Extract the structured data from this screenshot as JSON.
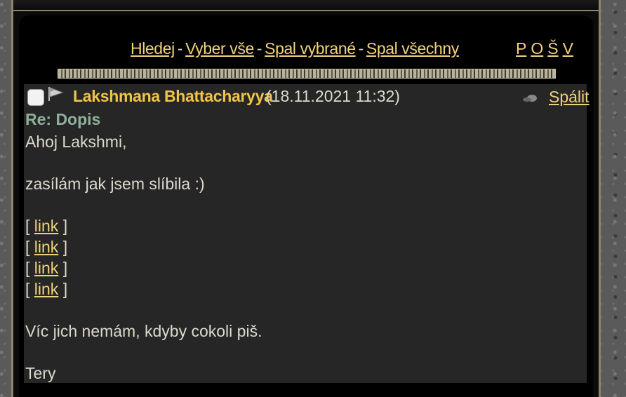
{
  "nav": {
    "search": "Hledej",
    "select_all": "Vyber vše",
    "burn_selected": "Spal vybrané",
    "burn_all": "Spal všechny",
    "separator": "-",
    "letters": [
      "P",
      "O",
      "Š",
      "V"
    ]
  },
  "message": {
    "sender": "Lakshmana Bhattacharyya",
    "date": "(18.11.2021 11:32)",
    "burn_label": "Spálit",
    "subject": "Re: Dopis",
    "greeting": "Ahoj Lakshmi,",
    "line1": "zasílám jak jsem slíbila :)",
    "links": [
      {
        "open": "[",
        "label": "link",
        "close": "]"
      },
      {
        "open": "[",
        "label": "link",
        "close": "]"
      },
      {
        "open": "[",
        "label": "link",
        "close": "]"
      },
      {
        "open": "[",
        "label": "link",
        "close": "]"
      }
    ],
    "line2": "Víc jich nemám, kdyby cokoli piš.",
    "signature": "Tery"
  },
  "colors": {
    "link": "#f0d27c",
    "sender": "#f0c449",
    "subject": "#8fb09a",
    "message_bg": "#262626"
  },
  "icons": [
    "flag-icon",
    "burn-icon"
  ]
}
